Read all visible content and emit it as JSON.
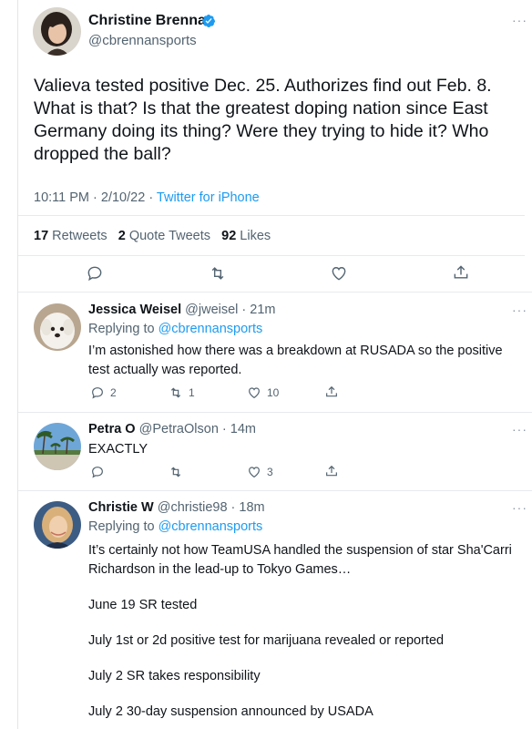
{
  "main_tweet": {
    "author_name": "Christine Brennan",
    "verified": true,
    "handle": "@cbrennansports",
    "text": "Valieva tested positive Dec. 25. Authorizes find out Feb. 8. What is that? Is that the greatest doping nation since East Germany doing its thing? Were they trying to hide it? Who dropped the ball?",
    "time": "10:11 PM",
    "date": "2/10/22",
    "source": "Twitter for iPhone",
    "retweets_count": "17",
    "retweets_label": "Retweets",
    "quotes_count": "2",
    "quotes_label": "Quote Tweets",
    "likes_count": "92",
    "likes_label": "Likes",
    "more": "···"
  },
  "replies": [
    {
      "name": "Jessica Weisel",
      "handle": "@jweisel",
      "time": "21m",
      "replying_prefix": "Replying to",
      "replying_to": "@cbrennansports",
      "text": "I’m astonished how there was a breakdown at RUSADA so the positive test actually was reported.",
      "replies": "2",
      "retweets": "1",
      "likes": "10",
      "more": "···"
    },
    {
      "name": "Petra O",
      "handle": "@PetraOlson",
      "time": "14m",
      "text": "EXACTLY",
      "likes": "3",
      "more": "···"
    },
    {
      "name": "Christie W",
      "handle": "@christie98",
      "time": "18m",
      "replying_prefix": "Replying to",
      "replying_to": "@cbrennansports",
      "paragraphs": [
        "It’s certainly not how TeamUSA handled the suspension of star Sha'Carri Richardson in the lead-up to Tokyo Games…",
        "June 19 SR tested",
        "July 1st or 2d positive test for marijuana revealed or reported",
        "July 2 SR takes responsibility",
        "July 2 30-day suspension announced by USADA"
      ],
      "more": "···"
    }
  ],
  "colors": {
    "text": "#0f1419",
    "secondary": "#536471",
    "accent": "#1d9bf0",
    "divider": "#e7eaed"
  }
}
